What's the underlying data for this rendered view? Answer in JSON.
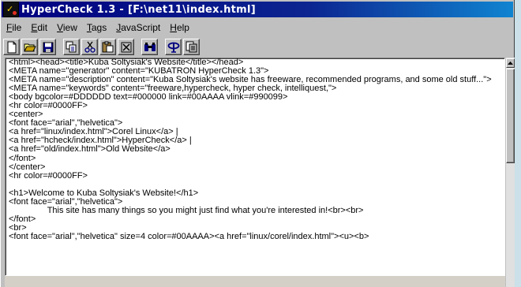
{
  "window": {
    "title": "HyperCheck 1.3 - [F:\\net11\\index.html]"
  },
  "menu": {
    "items": [
      {
        "acc": "F",
        "rest": "ile"
      },
      {
        "acc": "E",
        "rest": "dit"
      },
      {
        "acc": "V",
        "rest": "iew"
      },
      {
        "acc": "T",
        "rest": "ags"
      },
      {
        "acc": "J",
        "rest": "avaScript"
      },
      {
        "acc": "H",
        "rest": "elp"
      }
    ]
  },
  "toolbar": {
    "buttons": [
      "new-file-icon",
      "open-folder-icon",
      "save-disk-icon",
      "copy-icon",
      "cut-scissors-icon",
      "paste-clipboard-icon",
      "delete-icon",
      "find-binoculars-icon",
      "check-links-icon",
      "preview-icon"
    ]
  },
  "editor": {
    "lines": [
      "<html><head><title>Kuba Soltysiak's Website</title></head>",
      "<META name=\"generator\" content=\"KUBATRON HyperCheck 1.3\">",
      "<META name=\"description\" content=\"Kuba Soltysiak's website has freeware, recommended programs, and some old stuff...\">",
      "<META name=\"keywords\" content=\"freeware,hypercheck, hyper check, intelliquest,\">",
      "<body bgcolor=#DDDDDD text=#000000 link=#00AAAA vlink=#990099>",
      "<hr color=#0000FF>",
      "<center>",
      "<font face=\"arial\",\"helvetica\">",
      "<a href=\"linux/index.html\">Corel Linux</a> |",
      "<a href=\"hcheck/index.html\">HyperCheck</a> |",
      "<a href=\"old/index.html\">Old Website</a>",
      "</font>",
      "</center>",
      "<hr color=#0000FF>",
      "",
      "<h1>Welcome to Kuba Soltysiak's Website!</h1>",
      "<font face=\"arial\",\"helvetica\">",
      "                This site has many things so you might just find what you're interested in!<br><br>",
      "</font>",
      "<br>",
      "<font face=\"arial\",\"helvetica\" size=4 color=#00AAAA><a href=\"linux/corel/index.html\"><u><b>"
    ]
  }
}
